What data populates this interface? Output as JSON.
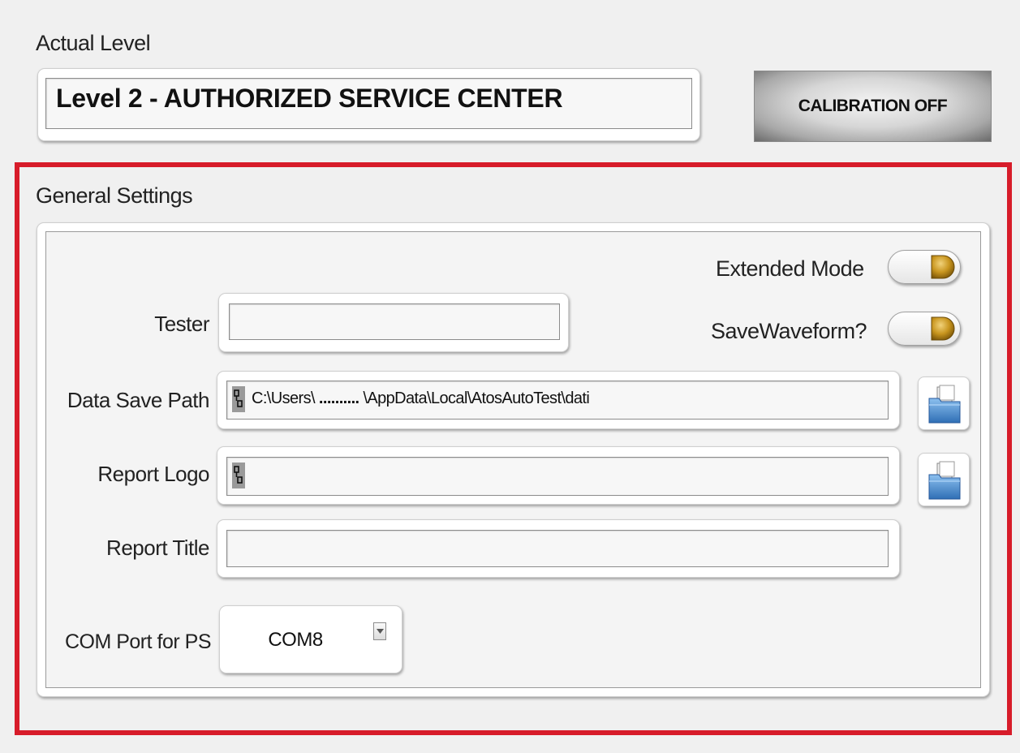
{
  "actual_level": {
    "label": "Actual Level",
    "value": "Level 2 - AUTHORIZED SERVICE CENTER"
  },
  "calibration_button": {
    "label": "CALIBRATION OFF"
  },
  "general_settings": {
    "title": "General Settings",
    "extended_mode": {
      "label": "Extended Mode",
      "state": "off"
    },
    "save_waveform": {
      "label": "SaveWaveform?",
      "state": "off"
    },
    "tester": {
      "label": "Tester",
      "value": ""
    },
    "data_save_path": {
      "label": "Data Save Path",
      "prefix": "C:\\Users\\",
      "masked": " ..........",
      "suffix": " \\AppData\\Local\\AtosAutoTest\\dati"
    },
    "report_logo": {
      "label": "Report Logo",
      "value": ""
    },
    "report_title": {
      "label": "Report Title",
      "value": ""
    },
    "com_port": {
      "label": "COM Port for PS",
      "value": "COM8"
    }
  },
  "icons": {
    "path": "path-icon",
    "browse": "folder-browse-icon",
    "toggle_knob": "toggle-knob-icon",
    "dropdown": "dropdown-arrow-icon"
  },
  "colors": {
    "highlight": "#d71c2a",
    "toggle_knob": "#c8951e",
    "folder": "#4a86c8",
    "background": "#f0f0f0"
  }
}
